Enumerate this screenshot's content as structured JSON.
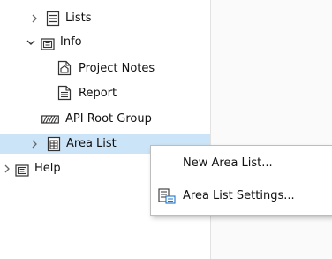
{
  "tree": {
    "items": [
      {
        "label": "Lists",
        "icon": "list-document-icon",
        "expanded": false
      },
      {
        "label": "Info",
        "icon": "layout-book-icon",
        "expanded": true
      },
      {
        "label": "Project Notes",
        "icon": "notes-document-icon"
      },
      {
        "label": "Report",
        "icon": "report-document-icon"
      },
      {
        "label": "API Root Group",
        "icon": "hatched-group-icon"
      },
      {
        "label": "Area List",
        "icon": "area-list-icon",
        "expanded": false,
        "selected": true
      },
      {
        "label": "Help",
        "icon": "layout-book-icon",
        "expanded": false
      }
    ]
  },
  "context_menu": {
    "items": [
      {
        "label": "New Area List...",
        "icon": ""
      },
      {
        "label": "Area List Settings...",
        "icon": "list-settings-icon"
      }
    ]
  },
  "colors": {
    "selection": "#cce4f7",
    "accent": "#1e73c8"
  }
}
